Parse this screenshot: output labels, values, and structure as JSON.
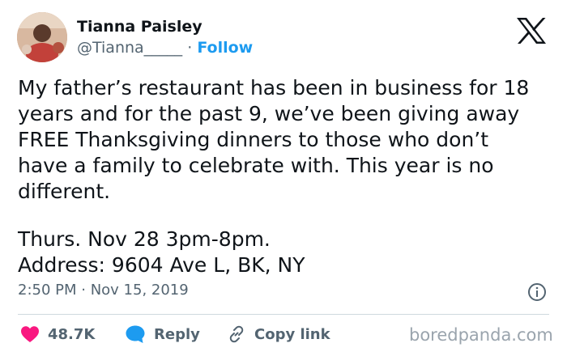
{
  "author": {
    "name": "Tianna Paisley",
    "handle": "@Tianna_____",
    "separator": "·",
    "follow_label": "Follow"
  },
  "tweet": {
    "paragraph1": "My father’s restaurant has been in business for 18\nyears and for the past 9, we’ve been giving away\nFREE Thanksgiving dinners to those who don’t\nhave a family to celebrate with. This year is no\ndifferent.",
    "paragraph2": "Thurs. Nov 28 3pm-8pm.\nAddress: 9604 Ave L, BK, NY",
    "timestamp": "2:50 PM · Nov 15, 2019"
  },
  "actions": {
    "like_count": "48.7K",
    "reply_label": "Reply",
    "copy_link_label": "Copy link"
  },
  "watermark": "boredpanda.com",
  "colors": {
    "link": "#1d9bf0",
    "muted": "#536471",
    "like": "#f91880",
    "text": "#0f1419"
  }
}
